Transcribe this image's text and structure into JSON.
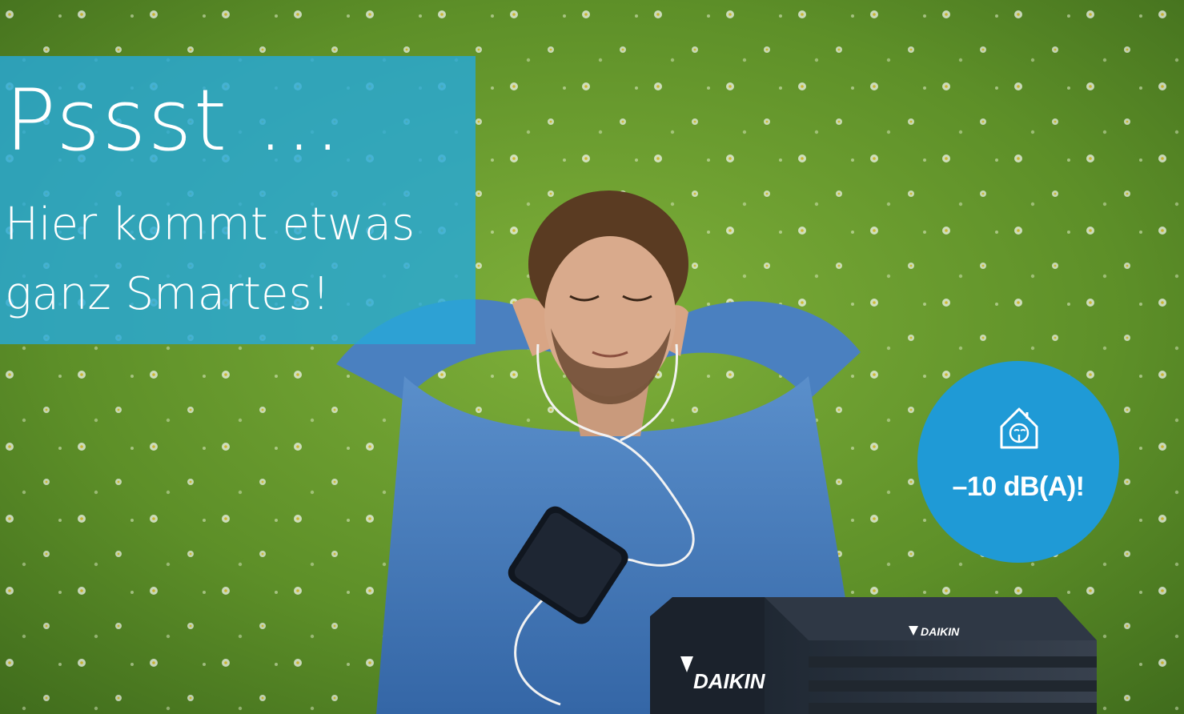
{
  "headline": {
    "main": "Pssst ...",
    "line1": "Hier kommt etwas",
    "line2": "ganz Smartes!"
  },
  "badge": {
    "icon": "quiet-house-icon",
    "text": "–10 dB(A)!"
  },
  "product": {
    "brand_front": "DAIKIN",
    "brand_top": "DAIKIN"
  },
  "colors": {
    "headline_box": "#27a8d8",
    "badge": "#1f9ad6",
    "grass": "#5f8f2a",
    "shirt": "#3f76b8",
    "unit": "#2a3340"
  }
}
